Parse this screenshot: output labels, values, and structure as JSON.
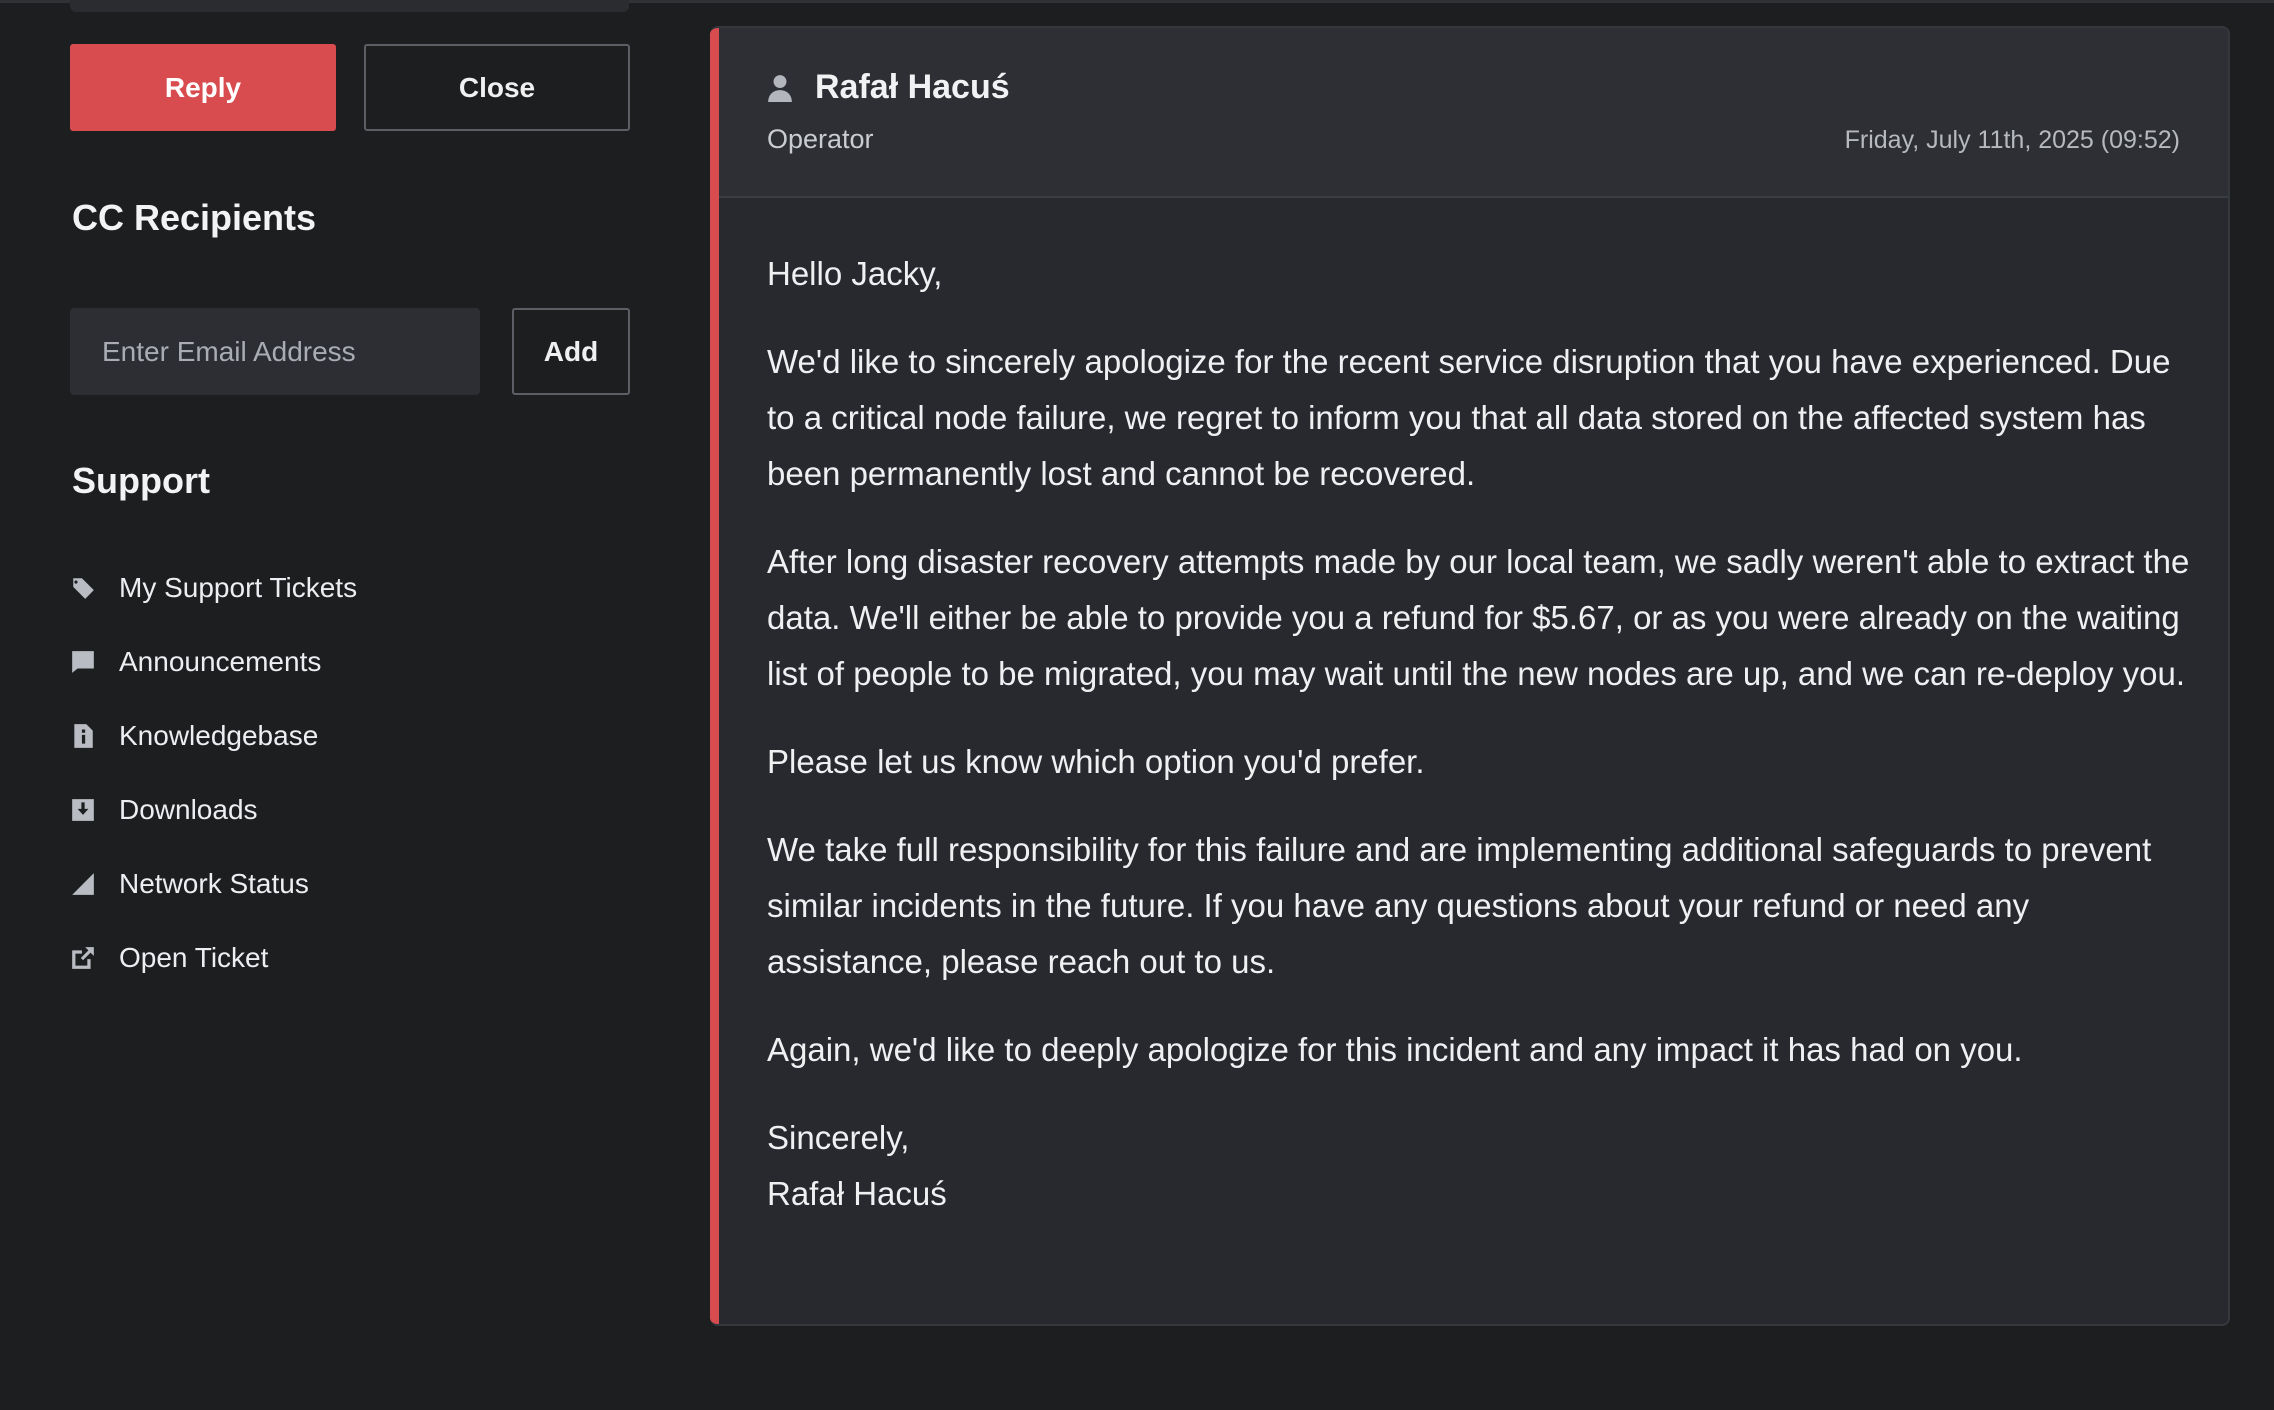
{
  "actions": {
    "reply_label": "Reply",
    "close_label": "Close"
  },
  "cc": {
    "title": "CC Recipients",
    "email_placeholder": "Enter Email Address",
    "email_value": "",
    "add_label": "Add"
  },
  "support": {
    "title": "Support",
    "items": [
      {
        "label": "My Support Tickets",
        "icon": "ticket-icon"
      },
      {
        "label": "Announcements",
        "icon": "comment-icon"
      },
      {
        "label": "Knowledgebase",
        "icon": "info-document-icon"
      },
      {
        "label": "Downloads",
        "icon": "download-icon"
      },
      {
        "label": "Network Status",
        "icon": "signal-icon"
      },
      {
        "label": "Open Ticket",
        "icon": "external-link-icon"
      }
    ]
  },
  "message": {
    "author": "Rafał Hacuś",
    "role": "Operator",
    "date": "Friday, July 11th, 2025 (09:52)",
    "accent_color": "#d84b4f",
    "paragraphs": [
      "Hello Jacky,",
      "We'd like to sincerely apologize for the recent service disruption that you have experienced. Due to a critical node failure, we regret to inform you that all data stored on the affected system has been permanently lost and cannot be recovered.",
      "After long disaster recovery attempts made by our local team, we sadly weren't able to extract the data. We'll either be able to provide you a refund for $5.67, or as you were already on the waiting list of people to be migrated, you may wait until the new nodes are up, and we can re-deploy you.",
      "Please let us know which option you'd prefer.",
      "We take full responsibility for this failure and are implementing additional safeguards to prevent similar incidents in the future. If you have any questions about your refund or need any assistance, please reach out to us.",
      "Again, we'd like to deeply apologize for this incident and any impact it has had on you."
    ],
    "signoff": "Sincerely,",
    "signature": "Rafał Hacuś"
  }
}
